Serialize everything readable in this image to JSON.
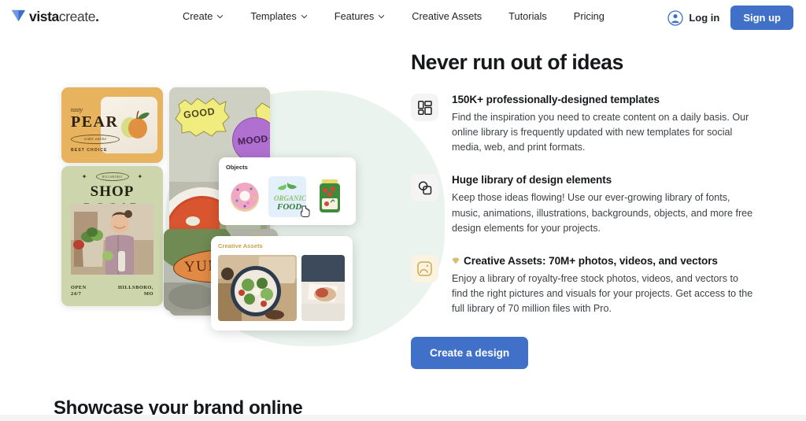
{
  "header": {
    "logo": {
      "mark": "v-triangle-icon",
      "bold": "vista",
      "light": "create",
      "dot": "."
    },
    "nav": [
      {
        "label": "Create",
        "has_dropdown": true
      },
      {
        "label": "Templates",
        "has_dropdown": true
      },
      {
        "label": "Features",
        "has_dropdown": true
      },
      {
        "label": "Creative Assets",
        "has_dropdown": false
      },
      {
        "label": "Tutorials",
        "has_dropdown": false
      },
      {
        "label": "Pricing",
        "has_dropdown": false
      }
    ],
    "login_label": "Log in",
    "login_icon": "user-avatar-icon",
    "signup_label": "Sign up",
    "signup_color": "#4070c8"
  },
  "illustration": {
    "pear_card": {
      "tasty": "tasty",
      "title": "PEAR",
      "oval": "order online",
      "footer": "BEST CHOICE",
      "bg_color": "#e8b35e"
    },
    "shop_card": {
      "badge": "HILLSBORO",
      "title": "SHOP LOCAL",
      "open_line1": "OPEN",
      "open_line2": "24/7",
      "city_line1": "HILLSBORO,",
      "city_line2": "MO",
      "bg_color": "#ccd5ab"
    },
    "mood_card": {
      "sticker_good": "GOOD",
      "sticker_mood": "MOOD"
    },
    "yummy_card": {
      "label": "YUMMY",
      "bg_color": "#e08a45"
    },
    "objects_panel": {
      "label": "Objects",
      "items": [
        "donut-graphic",
        "organic-food-graphic",
        "jam-jar-graphic"
      ],
      "selected_index": 1,
      "cursor": "hand-cursor-icon"
    },
    "assets_panel": {
      "label": "Creative Assets",
      "label_color": "#c9a24a",
      "items": [
        "salad-bowl-photo",
        "sandwich-photo"
      ]
    }
  },
  "main": {
    "heading": "Never run out of ideas",
    "features": [
      {
        "icon": "templates-grid-icon",
        "title": "150K+ professionally-designed templates",
        "desc": "Find the inspiration you need to create content on a daily basis. Our online library is frequently updated with new templates for social media, web, and print formats."
      },
      {
        "icon": "shapes-icon",
        "title": "Huge library of design elements",
        "desc": "Keep those ideas flowing! Use our ever-growing library of fonts, music, animations, illustrations, backgrounds, objects, and more free design elements for your projects."
      },
      {
        "icon": "image-asset-icon",
        "badge_icon": "gem-icon",
        "title": "Creative Assets: 70M+ photos, videos, and vectors",
        "desc": "Enjoy a library of royalty-free stock photos, videos, and vectors to find the right pictures and visuals for your projects. Get access to the full library of 70 million files with Pro."
      }
    ],
    "cta_label": "Create a design"
  },
  "bottom": {
    "heading": "Showcase your brand online"
  }
}
